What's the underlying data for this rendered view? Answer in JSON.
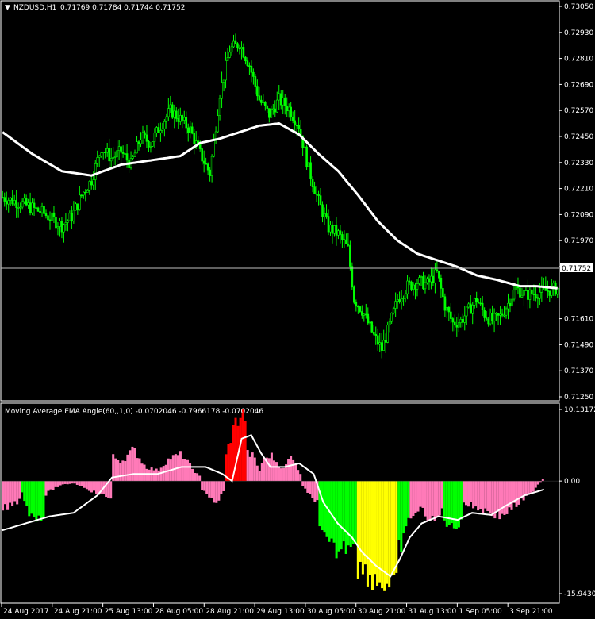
{
  "main_header": {
    "symbol": "NZDUSD,H1",
    "ohlc": "0.71769 0.71784 0.71744 0.71752"
  },
  "indicator_header": "Moving Average EMA Angle(60,,1,0) -0.0702046 -0.7966178 -0.0702046",
  "current_price_label": "0.71752",
  "colors": {
    "background": "#000000",
    "candle": "#00ff00",
    "ema_line": "#ffffff",
    "price_line": "#c0c0c0",
    "hist_pink": "#ff7ab8",
    "hist_green": "#00ff00",
    "hist_yellow": "#ffff00",
    "hist_red": "#ff0000",
    "grid_border": "#ffffff"
  },
  "chart_data": [
    {
      "type": "candlestick",
      "title": "NZDUSD,H1",
      "ylim": [
        0.7125,
        0.7305
      ],
      "y_ticks": [
        "0.73050",
        "0.72930",
        "0.72810",
        "0.72690",
        "0.72570",
        "0.72450",
        "0.72330",
        "0.72210",
        "0.72090",
        "0.71970",
        "0.71850",
        "0.71752",
        "0.71610",
        "0.71490",
        "0.71370",
        "0.71250"
      ],
      "x_ticks": [
        "24 Aug 2017",
        "24 Aug 21:00",
        "25 Aug 13:00",
        "28 Aug 05:00",
        "28 Aug 21:00",
        "29 Aug 13:00",
        "30 Aug 05:00",
        "30 Aug 21:00",
        "31 Aug 13:00",
        "1 Sep 05:00",
        "3 Sep 21:00"
      ],
      "price_path": [
        [
          0,
          0.7217
        ],
        [
          10,
          0.7214
        ],
        [
          20,
          0.721
        ],
        [
          30,
          0.7204
        ],
        [
          35,
          0.7208
        ],
        [
          40,
          0.7218
        ],
        [
          45,
          0.7225
        ],
        [
          50,
          0.724
        ],
        [
          55,
          0.7235
        ],
        [
          60,
          0.7238
        ],
        [
          65,
          0.7232
        ],
        [
          70,
          0.7245
        ],
        [
          75,
          0.7242
        ],
        [
          80,
          0.725
        ],
        [
          85,
          0.7257
        ],
        [
          90,
          0.7253
        ],
        [
          95,
          0.7248
        ],
        [
          100,
          0.7237
        ],
        [
          105,
          0.7228
        ],
        [
          110,
          0.7265
        ],
        [
          115,
          0.7285
        ],
        [
          120,
          0.7288
        ],
        [
          125,
          0.7278
        ],
        [
          130,
          0.7262
        ],
        [
          135,
          0.7255
        ],
        [
          140,
          0.7262
        ],
        [
          145,
          0.7258
        ],
        [
          150,
          0.725
        ],
        [
          155,
          0.723
        ],
        [
          160,
          0.7215
        ],
        [
          165,
          0.7203
        ],
        [
          170,
          0.72
        ],
        [
          175,
          0.7193
        ],
        [
          178,
          0.717
        ],
        [
          182,
          0.7165
        ],
        [
          188,
          0.7153
        ],
        [
          192,
          0.7147
        ],
        [
          196,
          0.7158
        ],
        [
          200,
          0.717
        ],
        [
          205,
          0.7176
        ],
        [
          210,
          0.7178
        ],
        [
          215,
          0.7177
        ],
        [
          220,
          0.7182
        ],
        [
          224,
          0.7167
        ],
        [
          228,
          0.7159
        ],
        [
          232,
          0.716
        ],
        [
          236,
          0.7165
        ],
        [
          240,
          0.717
        ],
        [
          244,
          0.7163
        ],
        [
          248,
          0.716
        ],
        [
          252,
          0.7162
        ],
        [
          256,
          0.7168
        ],
        [
          260,
          0.7175
        ],
        [
          265,
          0.7172
        ],
        [
          270,
          0.7173
        ],
        [
          276,
          0.7174
        ],
        [
          281,
          0.7175
        ]
      ],
      "ema": [
        [
          0,
          0.7247
        ],
        [
          15,
          0.7237
        ],
        [
          30,
          0.7229
        ],
        [
          45,
          0.7227
        ],
        [
          60,
          0.7232
        ],
        [
          75,
          0.7234
        ],
        [
          90,
          0.7236
        ],
        [
          100,
          0.7242
        ],
        [
          110,
          0.7244
        ],
        [
          120,
          0.7247
        ],
        [
          130,
          0.725
        ],
        [
          140,
          0.7251
        ],
        [
          150,
          0.7246
        ],
        [
          160,
          0.7237
        ],
        [
          170,
          0.7229
        ],
        [
          180,
          0.7218
        ],
        [
          190,
          0.7206
        ],
        [
          200,
          0.7197
        ],
        [
          210,
          0.7191
        ],
        [
          220,
          0.7188
        ],
        [
          230,
          0.7185
        ],
        [
          240,
          0.7181
        ],
        [
          250,
          0.7179
        ],
        [
          262,
          0.7176
        ],
        [
          270,
          0.7176
        ],
        [
          281,
          0.7175
        ]
      ]
    },
    {
      "type": "bar",
      "title": "Moving Average EMA Angle(60,,1,0)",
      "ylim": [
        -15.94309,
        10.13172
      ],
      "y_ticks": [
        "10.13172",
        "0.00",
        "-15.94309"
      ],
      "histogram_segments": [
        {
          "from": 0,
          "to": 8,
          "color": "pink",
          "path": [
            [
              0,
              -4
            ],
            [
              4,
              -3.5
            ],
            [
              8,
              -2.5
            ]
          ]
        },
        {
          "from": 8,
          "to": 18,
          "color": "green",
          "path": [
            [
              8,
              -1
            ],
            [
              12,
              -5
            ],
            [
              18,
              -5
            ]
          ]
        },
        {
          "from": 18,
          "to": 46,
          "color": "pink",
          "path": [
            [
              18,
              -2
            ],
            [
              22,
              -1
            ],
            [
              26,
              -0.5
            ],
            [
              30,
              -0.3
            ],
            [
              34,
              -0.8
            ],
            [
              38,
              -1.5
            ],
            [
              42,
              -2
            ],
            [
              46,
              -2.5
            ]
          ]
        },
        {
          "from": 46,
          "to": 83,
          "color": "pink",
          "path": [
            [
              46,
              3.5
            ],
            [
              50,
              2.8
            ],
            [
              55,
              4.5
            ],
            [
              60,
              2
            ],
            [
              65,
              1.5
            ],
            [
              70,
              3.2
            ],
            [
              75,
              3.8
            ],
            [
              80,
              1.5
            ],
            [
              83,
              0.5
            ]
          ]
        },
        {
          "from": 83,
          "to": 93,
          "color": "pink",
          "path": [
            [
              83,
              -1
            ],
            [
              87,
              -2.5
            ],
            [
              90,
              -3
            ],
            [
              93,
              -1
            ]
          ]
        },
        {
          "from": 93,
          "to": 102,
          "color": "red",
          "path": [
            [
              93,
              3
            ],
            [
              97,
              8
            ],
            [
              100,
              9.5
            ],
            [
              102,
              9
            ]
          ]
        },
        {
          "from": 102,
          "to": 108,
          "color": "pink",
          "path": [
            [
              102,
              4
            ],
            [
              105,
              3.5
            ],
            [
              108,
              1
            ]
          ]
        },
        {
          "from": 108,
          "to": 118,
          "color": "pink",
          "path": [
            [
              108,
              2.5
            ],
            [
              112,
              3.8
            ],
            [
              115,
              2.5
            ],
            [
              118,
              1.5
            ]
          ]
        },
        {
          "from": 118,
          "to": 125,
          "color": "pink",
          "path": [
            [
              118,
              2
            ],
            [
              121,
              3.8
            ],
            [
              125,
              0.5
            ]
          ]
        },
        {
          "from": 125,
          "to": 132,
          "color": "pink",
          "path": [
            [
              125,
              -0.5
            ],
            [
              128,
              -2
            ],
            [
              132,
              -3
            ]
          ]
        },
        {
          "from": 132,
          "to": 148,
          "color": "green",
          "path": [
            [
              132,
              -7
            ],
            [
              136,
              -9
            ],
            [
              140,
              -10
            ],
            [
              144,
              -9
            ],
            [
              148,
              -8
            ]
          ]
        },
        {
          "from": 148,
          "to": 165,
          "color": "yellow",
          "path": [
            [
              148,
              -12
            ],
            [
              152,
              -13
            ],
            [
              156,
              -14
            ],
            [
              160,
              -14.5
            ],
            [
              163,
              -15.5
            ],
            [
              165,
              -14
            ]
          ]
        },
        {
          "from": 165,
          "to": 170,
          "color": "green",
          "path": [
            [
              165,
              -10
            ],
            [
              168,
              -8
            ],
            [
              170,
              -5
            ]
          ]
        },
        {
          "from": 170,
          "to": 184,
          "color": "pink",
          "path": [
            [
              170,
              -5
            ],
            [
              175,
              -4
            ],
            [
              180,
              -6
            ],
            [
              184,
              -4
            ]
          ]
        },
        {
          "from": 184,
          "to": 192,
          "color": "green",
          "path": [
            [
              184,
              -5
            ],
            [
              188,
              -7
            ],
            [
              192,
              -5
            ]
          ]
        },
        {
          "from": 192,
          "to": 222,
          "color": "pink",
          "path": [
            [
              192,
              -3
            ],
            [
              200,
              -4
            ],
            [
              208,
              -5
            ],
            [
              214,
              -3.5
            ],
            [
              218,
              -2.5
            ],
            [
              222,
              -1.5
            ]
          ]
        },
        {
          "from": 222,
          "to": 226,
          "color": "pink",
          "path": [
            [
              222,
              -1
            ],
            [
              226,
              0.4
            ]
          ]
        }
      ],
      "signal_path": [
        [
          0,
          -7
        ],
        [
          10,
          -6
        ],
        [
          20,
          -5
        ],
        [
          30,
          -4.5
        ],
        [
          40,
          -2
        ],
        [
          46,
          0.5
        ],
        [
          55,
          1
        ],
        [
          65,
          1
        ],
        [
          75,
          2
        ],
        [
          85,
          2
        ],
        [
          92,
          1
        ],
        [
          96,
          0
        ],
        [
          100,
          6
        ],
        [
          104,
          6.5
        ],
        [
          108,
          4
        ],
        [
          112,
          2
        ],
        [
          118,
          2
        ],
        [
          124,
          2.5
        ],
        [
          130,
          1
        ],
        [
          134,
          -3
        ],
        [
          140,
          -6
        ],
        [
          146,
          -8
        ],
        [
          150,
          -10
        ],
        [
          156,
          -12
        ],
        [
          162,
          -13.5
        ],
        [
          166,
          -11
        ],
        [
          170,
          -8
        ],
        [
          175,
          -6
        ],
        [
          182,
          -5
        ],
        [
          190,
          -5.5
        ],
        [
          196,
          -4.5
        ],
        [
          204,
          -4.8
        ],
        [
          210,
          -3.5
        ],
        [
          218,
          -2
        ],
        [
          226,
          -1.2
        ]
      ]
    }
  ]
}
